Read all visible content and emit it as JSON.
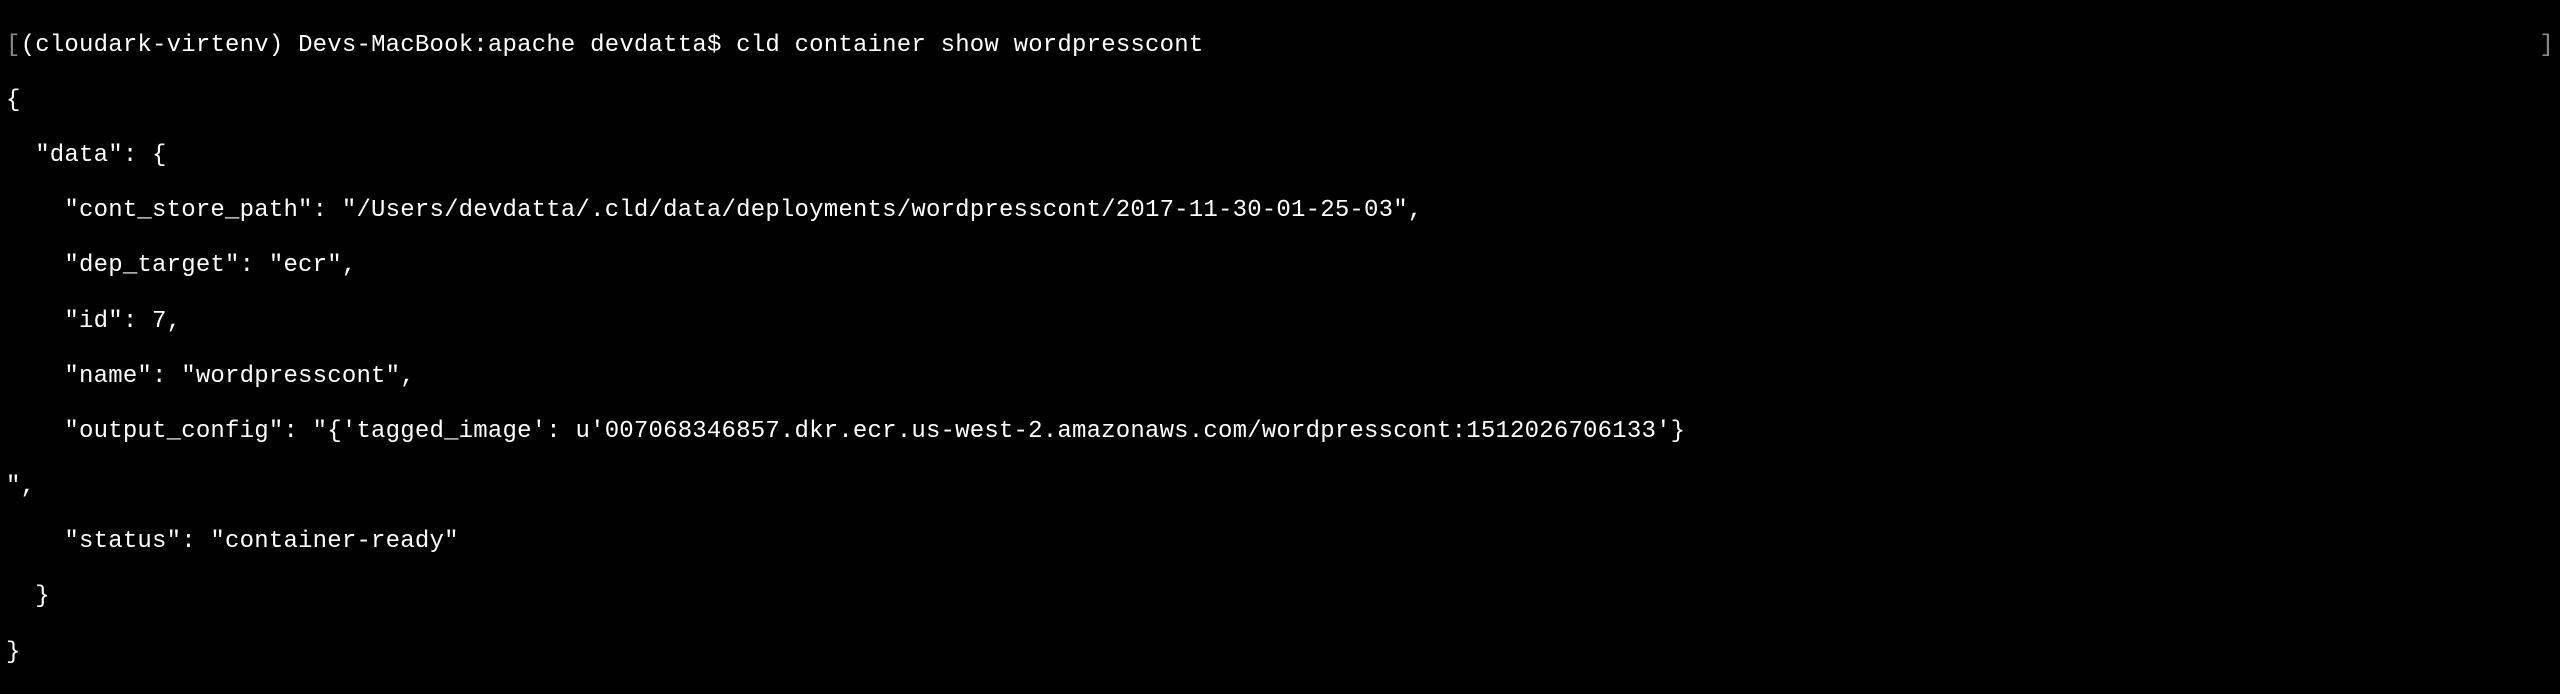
{
  "prompt": {
    "open_bracket": "[",
    "venv": "(cloudark-virtenv) ",
    "host": "Devs-MacBook:",
    "cwd": "apache ",
    "user": "devdatta$ ",
    "command": "cld container show wordpresscont",
    "close_bracket": "]"
  },
  "output": {
    "l1": "{",
    "l2": "  \"data\": {",
    "l3": "    \"cont_store_path\": \"/Users/devdatta/.cld/data/deployments/wordpresscont/2017-11-30-01-25-03\",",
    "l4": "    \"dep_target\": \"ecr\",",
    "l5": "    \"id\": 7,",
    "l6": "    \"name\": \"wordpresscont\",",
    "l7": "    \"output_config\": \"{'tagged_image': u'007068346857.dkr.ecr.us-west-2.amazonaws.com/wordpresscont:1512026706133'}",
    "l8": "\",",
    "l9": "    \"status\": \"container-ready\"",
    "l10": "  }",
    "l11": "}"
  },
  "data_values": {
    "cont_store_path": "/Users/devdatta/.cld/data/deployments/wordpresscont/2017-11-30-01-25-03",
    "dep_target": "ecr",
    "id": 7,
    "name": "wordpresscont",
    "output_config": "{'tagged_image': u'007068346857.dkr.ecr.us-west-2.amazonaws.com/wordpresscont:1512026706133'}",
    "status": "container-ready"
  }
}
